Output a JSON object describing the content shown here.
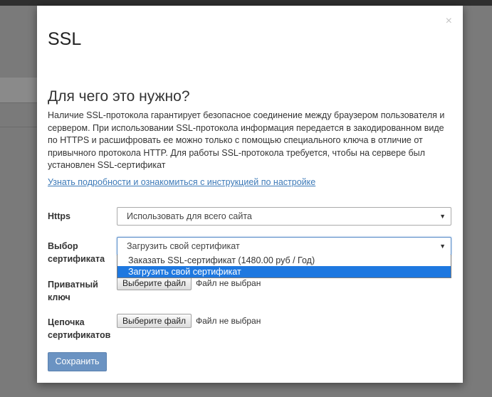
{
  "modal": {
    "close_symbol": "×",
    "title": "SSL",
    "heading": "Для чего это нужно?",
    "description": "Наличие SSL-протокола гарантирует безопасное соединение между браузером пользователя и сервером. При использовании SSL-протокола информация передается в закодированном виде по HTTPS и расшифровать ее можно только с помощью специального ключа в отличие от привычного протокола HTTP. Для работы SSL-протокола требуется, чтобы на сервере был установлен SSL-сертификат",
    "more_link": "Узнать подробности и ознакомиться с инструкцией по настройке"
  },
  "form": {
    "https": {
      "label": "Https",
      "value": "Использовать для всего сайта",
      "arrow": "▼"
    },
    "certificate": {
      "label": "Выбор сертификата",
      "value": "Загрузить свой сертификат",
      "arrow": "▼",
      "options": [
        "Заказать SSL-сертификат (1480.00 руб / Год)",
        "Загрузить свой сертификат"
      ],
      "selected_index": 1
    },
    "private_key": {
      "label": "Приватный ключ",
      "button": "Выберите файл",
      "status": "Файл не выбран"
    },
    "chain": {
      "label": "Цепочка сертификатов",
      "button": "Выберите файл",
      "status": "Файл не выбран"
    },
    "save_label": "Сохранить"
  },
  "colors": {
    "accent": "#6b93c2",
    "link": "#3d7ab8",
    "option_highlight": "#1e78e0"
  }
}
